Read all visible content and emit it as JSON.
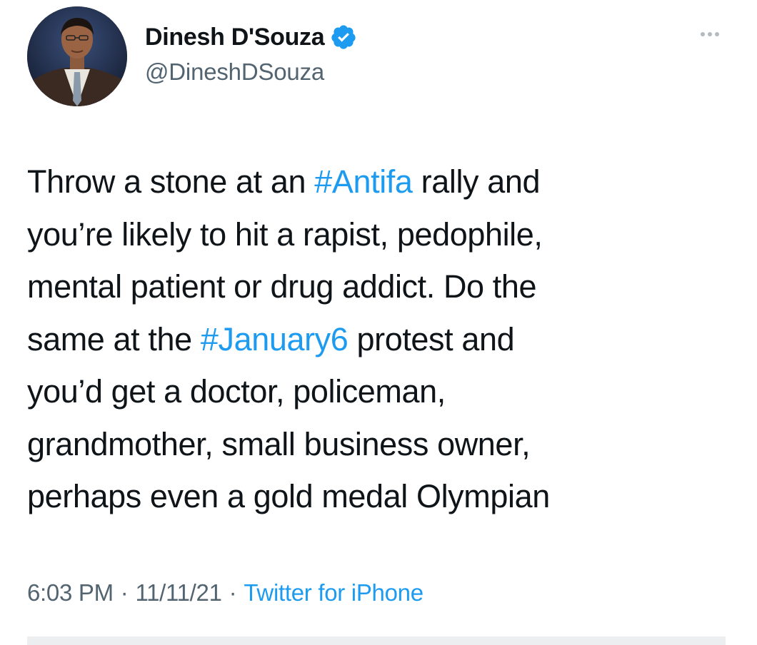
{
  "tweet": {
    "author": {
      "display_name": "Dinesh D'Souza",
      "handle": "@DineshDSouza",
      "verified": true
    },
    "more_icon": "more-dots-icon",
    "lines": [
      [
        {
          "text": "Throw a stone at an "
        },
        {
          "text": "#Antifa",
          "hashtag": true
        },
        {
          "text": " rally and"
        }
      ],
      [
        {
          "text": "you’re likely to hit a rapist, pedophile,"
        }
      ],
      [
        {
          "text": "mental patient or drug addict. Do the"
        }
      ],
      [
        {
          "text": "same at the "
        },
        {
          "text": "#January6",
          "hashtag": true
        },
        {
          "text": " protest and"
        }
      ],
      [
        {
          "text": "you’d get a doctor, policeman,"
        }
      ],
      [
        {
          "text": "grandmother, small business owner,"
        }
      ],
      [
        {
          "text": "perhaps even a gold medal Olympian"
        }
      ]
    ],
    "meta": {
      "time": "6:03 PM",
      "date": "11/11/21",
      "separator": "·",
      "source": "Twitter for iPhone"
    }
  },
  "colors": {
    "text": "#0f1419",
    "secondary": "#536471",
    "link": "#1d9bf0",
    "verified_badge": "#1d9bf0"
  }
}
